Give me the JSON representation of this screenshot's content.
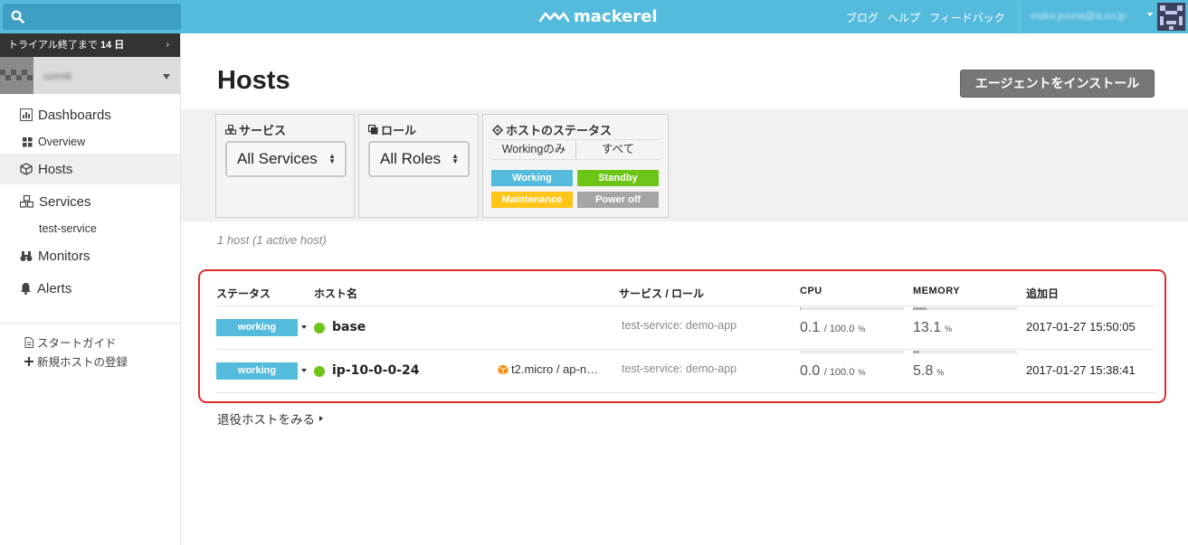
{
  "header": {
    "logo_text": "mackerel",
    "links": [
      "ブログ",
      "ヘルプ",
      "フィードバック"
    ],
    "user_email": "mako.yuuna@is.co.jp"
  },
  "sidebar": {
    "trial_text": "トライアル終了まで",
    "trial_days": "14 日",
    "org_name": "uzesk",
    "nav": {
      "dashboards": "Dashboards",
      "overview": "Overview",
      "hosts": "Hosts",
      "services": "Services",
      "test_service": "test-service",
      "monitors": "Monitors",
      "alerts": "Alerts"
    },
    "guide": "スタートガイド",
    "new_host": "新規ホストの登録"
  },
  "page": {
    "title": "Hosts",
    "install_button": "エージェントをインストール"
  },
  "filters": {
    "service_title": "サービス",
    "service_value": "All Services",
    "role_title": "ロール",
    "role_value": "All Roles",
    "status_title": "ホストのステータス",
    "status_tabs": [
      "Workingのみ",
      "すべて"
    ],
    "status_badges": [
      {
        "label": "Working",
        "color": "#55bbdd"
      },
      {
        "label": "Standby",
        "color": "#6cc417"
      },
      {
        "label": "Maintenance",
        "color": "#ffc619"
      },
      {
        "label": "Power off",
        "color": "#a5a5a5"
      }
    ]
  },
  "summary": "1 host (1 active host)",
  "table": {
    "headers": {
      "status": "ステータス",
      "name": "ホスト名",
      "service_role": "サービス / ロール",
      "cpu": "CPU",
      "memory": "MEMORY",
      "added": "追加日"
    },
    "rows": [
      {
        "status": "working",
        "name": "base",
        "meta": "",
        "roles": "test-service: demo-app",
        "cpu": "0.1",
        "cpu_total": "/ 100.0",
        "cpu_unit": "%",
        "memory": "13.1",
        "memory_unit": "%",
        "added": "2017-01-27 15:50:05"
      },
      {
        "status": "working",
        "name": "ip-10-0-0-24",
        "meta": "t2.micro / ap-n…",
        "roles": "test-service: demo-app",
        "cpu": "0.0",
        "cpu_total": "/ 100.0",
        "cpu_unit": "%",
        "memory": "5.8",
        "memory_unit": "%",
        "added": "2017-01-27 15:38:41"
      }
    ]
  },
  "retired_link": "退役ホストをみる"
}
